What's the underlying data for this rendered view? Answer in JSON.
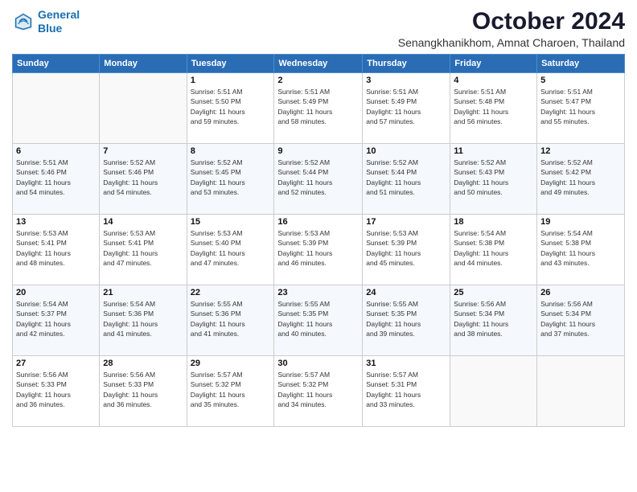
{
  "logo": {
    "line1": "General",
    "line2": "Blue"
  },
  "title": "October 2024",
  "location": "Senangkhanikhom, Amnat Charoen, Thailand",
  "headers": [
    "Sunday",
    "Monday",
    "Tuesday",
    "Wednesday",
    "Thursday",
    "Friday",
    "Saturday"
  ],
  "weeks": [
    [
      {
        "day": "",
        "info": ""
      },
      {
        "day": "",
        "info": ""
      },
      {
        "day": "1",
        "info": "Sunrise: 5:51 AM\nSunset: 5:50 PM\nDaylight: 11 hours\nand 59 minutes."
      },
      {
        "day": "2",
        "info": "Sunrise: 5:51 AM\nSunset: 5:49 PM\nDaylight: 11 hours\nand 58 minutes."
      },
      {
        "day": "3",
        "info": "Sunrise: 5:51 AM\nSunset: 5:49 PM\nDaylight: 11 hours\nand 57 minutes."
      },
      {
        "day": "4",
        "info": "Sunrise: 5:51 AM\nSunset: 5:48 PM\nDaylight: 11 hours\nand 56 minutes."
      },
      {
        "day": "5",
        "info": "Sunrise: 5:51 AM\nSunset: 5:47 PM\nDaylight: 11 hours\nand 55 minutes."
      }
    ],
    [
      {
        "day": "6",
        "info": "Sunrise: 5:51 AM\nSunset: 5:46 PM\nDaylight: 11 hours\nand 54 minutes."
      },
      {
        "day": "7",
        "info": "Sunrise: 5:52 AM\nSunset: 5:46 PM\nDaylight: 11 hours\nand 54 minutes."
      },
      {
        "day": "8",
        "info": "Sunrise: 5:52 AM\nSunset: 5:45 PM\nDaylight: 11 hours\nand 53 minutes."
      },
      {
        "day": "9",
        "info": "Sunrise: 5:52 AM\nSunset: 5:44 PM\nDaylight: 11 hours\nand 52 minutes."
      },
      {
        "day": "10",
        "info": "Sunrise: 5:52 AM\nSunset: 5:44 PM\nDaylight: 11 hours\nand 51 minutes."
      },
      {
        "day": "11",
        "info": "Sunrise: 5:52 AM\nSunset: 5:43 PM\nDaylight: 11 hours\nand 50 minutes."
      },
      {
        "day": "12",
        "info": "Sunrise: 5:52 AM\nSunset: 5:42 PM\nDaylight: 11 hours\nand 49 minutes."
      }
    ],
    [
      {
        "day": "13",
        "info": "Sunrise: 5:53 AM\nSunset: 5:41 PM\nDaylight: 11 hours\nand 48 minutes."
      },
      {
        "day": "14",
        "info": "Sunrise: 5:53 AM\nSunset: 5:41 PM\nDaylight: 11 hours\nand 47 minutes."
      },
      {
        "day": "15",
        "info": "Sunrise: 5:53 AM\nSunset: 5:40 PM\nDaylight: 11 hours\nand 47 minutes."
      },
      {
        "day": "16",
        "info": "Sunrise: 5:53 AM\nSunset: 5:39 PM\nDaylight: 11 hours\nand 46 minutes."
      },
      {
        "day": "17",
        "info": "Sunrise: 5:53 AM\nSunset: 5:39 PM\nDaylight: 11 hours\nand 45 minutes."
      },
      {
        "day": "18",
        "info": "Sunrise: 5:54 AM\nSunset: 5:38 PM\nDaylight: 11 hours\nand 44 minutes."
      },
      {
        "day": "19",
        "info": "Sunrise: 5:54 AM\nSunset: 5:38 PM\nDaylight: 11 hours\nand 43 minutes."
      }
    ],
    [
      {
        "day": "20",
        "info": "Sunrise: 5:54 AM\nSunset: 5:37 PM\nDaylight: 11 hours\nand 42 minutes."
      },
      {
        "day": "21",
        "info": "Sunrise: 5:54 AM\nSunset: 5:36 PM\nDaylight: 11 hours\nand 41 minutes."
      },
      {
        "day": "22",
        "info": "Sunrise: 5:55 AM\nSunset: 5:36 PM\nDaylight: 11 hours\nand 41 minutes."
      },
      {
        "day": "23",
        "info": "Sunrise: 5:55 AM\nSunset: 5:35 PM\nDaylight: 11 hours\nand 40 minutes."
      },
      {
        "day": "24",
        "info": "Sunrise: 5:55 AM\nSunset: 5:35 PM\nDaylight: 11 hours\nand 39 minutes."
      },
      {
        "day": "25",
        "info": "Sunrise: 5:56 AM\nSunset: 5:34 PM\nDaylight: 11 hours\nand 38 minutes."
      },
      {
        "day": "26",
        "info": "Sunrise: 5:56 AM\nSunset: 5:34 PM\nDaylight: 11 hours\nand 37 minutes."
      }
    ],
    [
      {
        "day": "27",
        "info": "Sunrise: 5:56 AM\nSunset: 5:33 PM\nDaylight: 11 hours\nand 36 minutes."
      },
      {
        "day": "28",
        "info": "Sunrise: 5:56 AM\nSunset: 5:33 PM\nDaylight: 11 hours\nand 36 minutes."
      },
      {
        "day": "29",
        "info": "Sunrise: 5:57 AM\nSunset: 5:32 PM\nDaylight: 11 hours\nand 35 minutes."
      },
      {
        "day": "30",
        "info": "Sunrise: 5:57 AM\nSunset: 5:32 PM\nDaylight: 11 hours\nand 34 minutes."
      },
      {
        "day": "31",
        "info": "Sunrise: 5:57 AM\nSunset: 5:31 PM\nDaylight: 11 hours\nand 33 minutes."
      },
      {
        "day": "",
        "info": ""
      },
      {
        "day": "",
        "info": ""
      }
    ]
  ]
}
